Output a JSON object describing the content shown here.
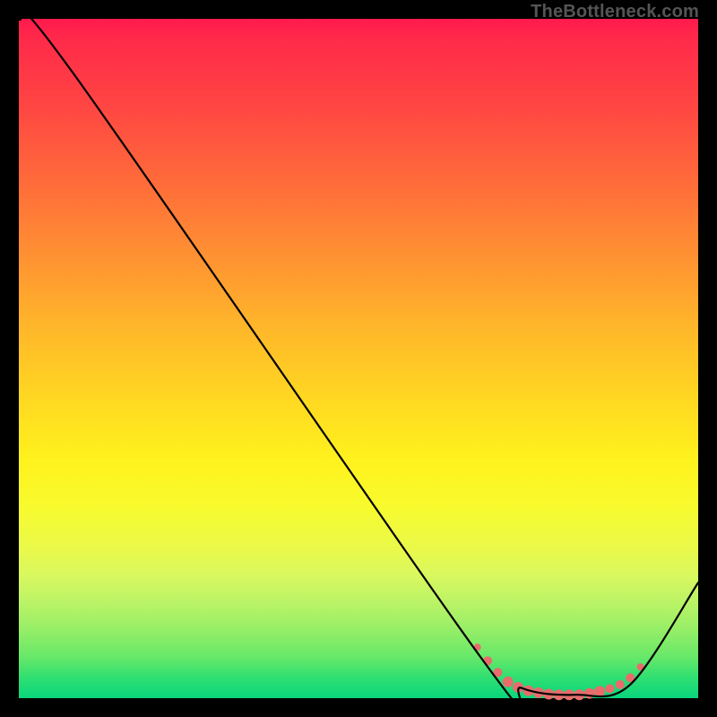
{
  "domain": "Chart",
  "watermark": "TheBottleneck.com",
  "chart_data": {
    "type": "line",
    "title": "",
    "xlabel": "",
    "ylabel": "",
    "xlim": [
      0,
      100
    ],
    "ylim": [
      0,
      100
    ],
    "series": [
      {
        "name": "curve",
        "points": [
          {
            "x": 0,
            "y": 100
          },
          {
            "x": 8,
            "y": 92
          },
          {
            "x": 68,
            "y": 6
          },
          {
            "x": 74,
            "y": 1.5
          },
          {
            "x": 82,
            "y": 0.5
          },
          {
            "x": 90,
            "y": 2
          },
          {
            "x": 100,
            "y": 17
          }
        ]
      }
    ],
    "markers": {
      "name": "bottom-markers",
      "color": "#e96c6c",
      "points": [
        {
          "x": 67.5,
          "y": 7.5,
          "r": 4
        },
        {
          "x": 69.0,
          "y": 5.5,
          "r": 5
        },
        {
          "x": 70.5,
          "y": 3.8,
          "r": 5
        },
        {
          "x": 72.0,
          "y": 2.4,
          "r": 6
        },
        {
          "x": 73.5,
          "y": 1.6,
          "r": 6
        },
        {
          "x": 75.0,
          "y": 1.1,
          "r": 6
        },
        {
          "x": 76.5,
          "y": 0.8,
          "r": 6
        },
        {
          "x": 78.0,
          "y": 0.6,
          "r": 6
        },
        {
          "x": 79.5,
          "y": 0.5,
          "r": 6
        },
        {
          "x": 81.0,
          "y": 0.5,
          "r": 6
        },
        {
          "x": 82.5,
          "y": 0.5,
          "r": 6
        },
        {
          "x": 84.0,
          "y": 0.7,
          "r": 6
        },
        {
          "x": 85.5,
          "y": 1.0,
          "r": 6
        },
        {
          "x": 87.0,
          "y": 1.4,
          "r": 5
        },
        {
          "x": 88.5,
          "y": 2.0,
          "r": 5
        },
        {
          "x": 90.0,
          "y": 3.0,
          "r": 5
        },
        {
          "x": 91.5,
          "y": 4.6,
          "r": 4
        }
      ]
    }
  }
}
